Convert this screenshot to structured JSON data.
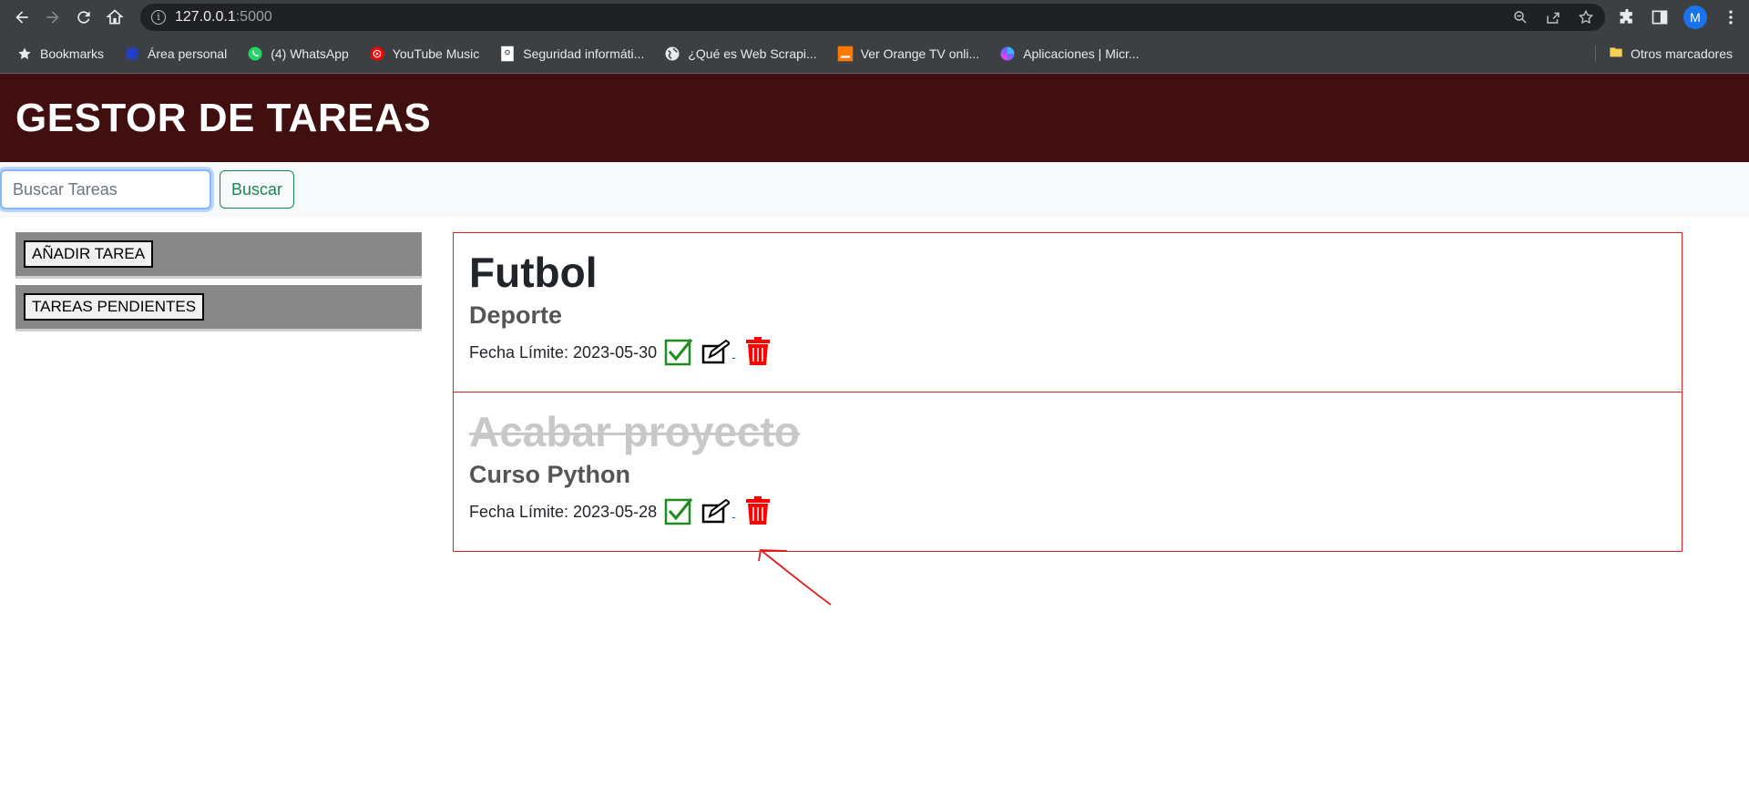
{
  "browser": {
    "url_host": "127.0.0.1",
    "url_port": ":5000",
    "avatar_letter": "M",
    "bookmarks": [
      {
        "label": "Bookmarks",
        "icon": "star-icon"
      },
      {
        "label": "Área personal",
        "icon": "puzzle-blue-icon"
      },
      {
        "label": "(4) WhatsApp",
        "icon": "whatsapp-icon"
      },
      {
        "label": "YouTube Music",
        "icon": "youtube-music-icon"
      },
      {
        "label": "Seguridad informáti...",
        "icon": "document-icon"
      },
      {
        "label": "¿Qué es Web Scrapi...",
        "icon": "globe-icon"
      },
      {
        "label": "Ver Orange TV onli...",
        "icon": "orange-icon"
      },
      {
        "label": "Aplicaciones | Micr...",
        "icon": "apps-icon"
      }
    ],
    "other_bookmarks": "Otros marcadores"
  },
  "app": {
    "title": "GESTOR DE TAREAS",
    "search_placeholder": "Buscar Tareas",
    "search_button": "Buscar",
    "sidebar": {
      "add_task": "AÑADIR TAREA",
      "pending_tasks": "TAREAS PENDIENTES"
    },
    "tasks": [
      {
        "title": "Futbol",
        "category": "Deporte",
        "due": "Fecha Límite: 2023-05-30",
        "completed": false,
        "separator": "-"
      },
      {
        "title": "Acabar proyecto",
        "category": "Curso Python",
        "due": "Fecha Límite: 2023-05-28",
        "completed": true,
        "separator": "-"
      }
    ]
  },
  "colors": {
    "header_bg": "#420f10",
    "task_border": "#e31b1b",
    "check_green": "#1e8c1e",
    "trash_red": "#ff0000",
    "search_button": "#198754"
  }
}
